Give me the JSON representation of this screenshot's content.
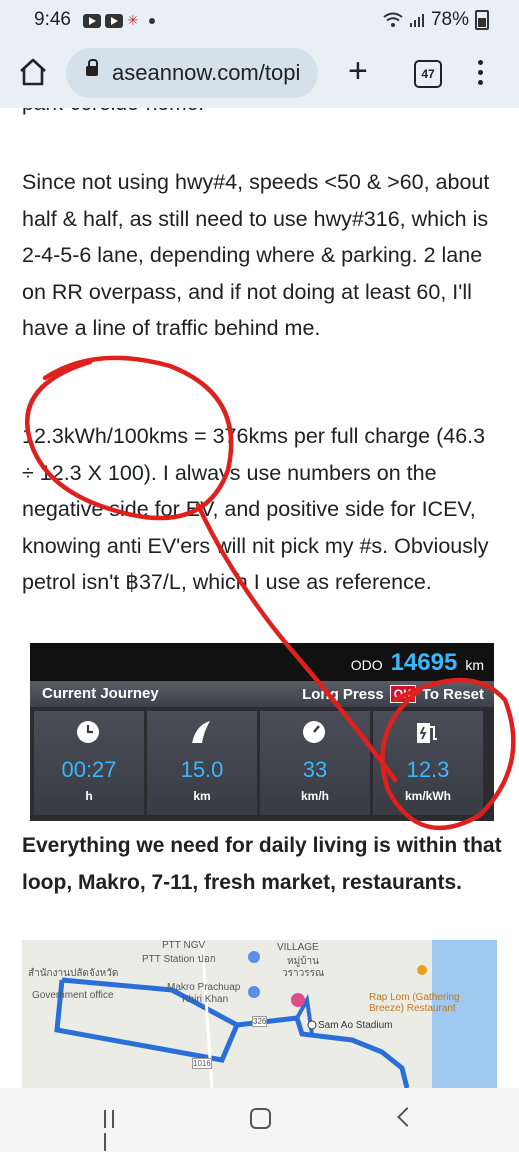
{
  "status_bar": {
    "time": "9:46",
    "battery": "78%"
  },
  "browser": {
    "url": "aseannow.com/topi",
    "tab_count": "47"
  },
  "post": {
    "cut_line": "park-cerelde-home.",
    "paragraphs": [
      "Since not using hwy#4, speeds <50 & >60, about half & half, as still need to use hwy#316, which is 2-4-5-6 lane, depending where & parking.  2 lane on RR overpass, and if not doing at least 60, I'll have a line of traffic behind me.",
      "12.3kWh/100kms = 376kms per full charge (46.3 ÷ 12.3 X 100).   I always use numbers on the negative side for EV, and positive side for ICEV, knowing anti EV'ers will nit pick my #s.  Obviously petrol isn't ฿37/L, which I use as reference."
    ],
    "bold_paragraph": "Everything we need for daily living is within that loop, Makro, 7-11, fresh market, restaurants."
  },
  "dashboard": {
    "odo_label": "ODO",
    "odo_value": "14695",
    "odo_unit": "km",
    "title": "Current Journey",
    "long_press": "Long Press",
    "ok": "OK",
    "to_reset": "To Reset",
    "cells": [
      {
        "icon": "clock-icon",
        "value": "00:27",
        "unit": "h"
      },
      {
        "icon": "road-icon",
        "value": "15.0",
        "unit": "km"
      },
      {
        "icon": "speedometer-icon",
        "value": "33",
        "unit": "km/h"
      },
      {
        "icon": "charger-icon",
        "value": "12.3",
        "unit": "km/kWh"
      }
    ]
  },
  "map": {
    "labels": [
      "PTT NGV",
      "PTT Station ปอก",
      "VILLAGE",
      "หมู่บ้าน",
      "วราวรรณ",
      "สำนักงานปลัดจังหวัด",
      "Government office",
      "Makro Prachuap",
      "Khiri Khan",
      "Rap Lom (Gathering Breeze) Restaurant",
      "Sam Ao Stadium",
      "326",
      "1016"
    ]
  },
  "colors": {
    "chrome_bg": "#e8f0f6",
    "annotation_red": "#e0201c",
    "dash_blue": "#3ab7ff"
  }
}
